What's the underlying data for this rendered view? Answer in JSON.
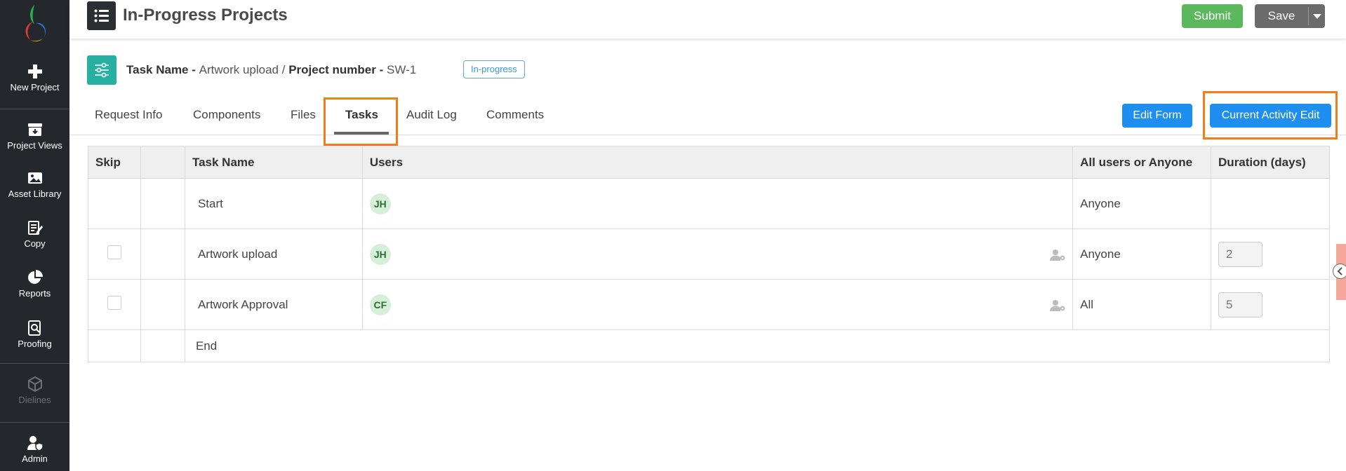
{
  "sidebar": {
    "items": [
      {
        "label": "New Project",
        "icon": "plus-icon"
      },
      {
        "label": "Project Views",
        "icon": "archive-icon"
      },
      {
        "label": "Asset Library",
        "icon": "image-icon"
      },
      {
        "label": "Copy",
        "icon": "edit-icon"
      },
      {
        "label": "Reports",
        "icon": "pie-chart-icon"
      },
      {
        "label": "Proofing",
        "icon": "proof-search-icon"
      },
      {
        "label": "Dielines",
        "icon": "box-icon",
        "disabled": true
      },
      {
        "label": "Admin",
        "icon": "user-shield-icon"
      }
    ]
  },
  "header": {
    "title": "In-Progress Projects",
    "submit_label": "Submit",
    "save_label": "Save"
  },
  "task": {
    "task_name_label": "Task Name - ",
    "task_name_value": "Artwork upload",
    "separator": " / ",
    "project_number_label": "Project number - ",
    "project_number_value": "SW-1",
    "status": "In-progress"
  },
  "tabs": [
    "Request Info",
    "Components",
    "Files",
    "Tasks",
    "Audit Log",
    "Comments"
  ],
  "active_tab": "Tasks",
  "actions": {
    "edit_form": "Edit Form",
    "current_activity_edit": "Current Activity Edit"
  },
  "table": {
    "headers": [
      "Skip",
      "",
      "Task Name",
      "Users",
      "All users or Anyone",
      "Duration (days)"
    ],
    "rows": [
      {
        "skip_checkbox": false,
        "task": "Start",
        "user": "JH",
        "mode": "Anyone",
        "duration": ""
      },
      {
        "skip_checkbox": true,
        "task": "Artwork upload",
        "user": "JH",
        "mode": "Anyone",
        "duration": "2"
      },
      {
        "skip_checkbox": true,
        "task": "Artwork Approval",
        "user": "CF",
        "mode": "All",
        "duration": "5"
      },
      {
        "skip_checkbox": false,
        "task": "End",
        "user": "",
        "mode": "",
        "duration": ""
      }
    ]
  },
  "colors": {
    "sidebar_bg": "#24282d",
    "submit": "#5cb85c",
    "save": "#6b6b6b",
    "primary": "#1e8ef0",
    "highlight": "#f07d1a",
    "teal": "#27b0a2"
  }
}
